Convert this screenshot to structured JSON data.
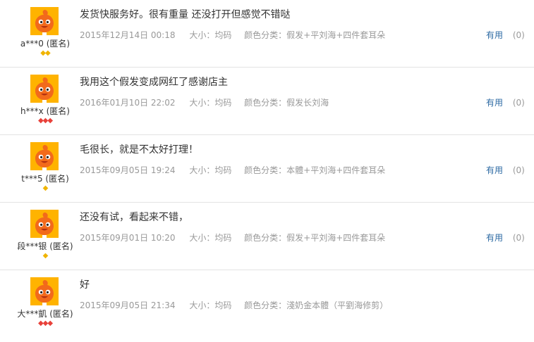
{
  "reviews": [
    {
      "user": "a***0 (匿名)",
      "badges": [
        {
          "color": "yellow"
        },
        {
          "color": "yellow"
        }
      ],
      "content": "发货快服务好。很有重量 还没打开但感觉不错哒",
      "date": "2015年12月14日 00:18",
      "size": "大小：均码",
      "color": "颜色分类：假发+平刘海+四件套耳朵",
      "useful_label": "有用",
      "useful_count": "(0)"
    },
    {
      "user": "h***x (匿名)",
      "badges": [
        {
          "color": "red"
        },
        {
          "color": "red"
        },
        {
          "color": "red"
        }
      ],
      "content": "我用这个假发变成网红了感谢店主",
      "date": "2016年01月10日 22:02",
      "size": "大小：均码",
      "color": "颜色分类：假发长刘海",
      "useful_label": "有用",
      "useful_count": "(0)"
    },
    {
      "user": "t***5 (匿名)",
      "badges": [
        {
          "color": "yellow"
        }
      ],
      "content": "毛很长，就是不太好打理！",
      "date": "2015年09月05日 19:24",
      "size": "大小：均码",
      "color": "颜色分类：本體+平刘海+四件套耳朵",
      "useful_label": "有用",
      "useful_count": "(0)"
    },
    {
      "user": "段***银 (匿名)",
      "badges": [
        {
          "color": "yellow"
        }
      ],
      "content": "还没有试，看起来不错，",
      "date": "2015年09月01日 10:20",
      "size": "大小：均码",
      "color": "颜色分类：假发+平刘海+四件套耳朵",
      "useful_label": "有用",
      "useful_count": "(0)"
    },
    {
      "user": "大***凱 (匿名)",
      "badges": [
        {
          "color": "red"
        },
        {
          "color": "red"
        },
        {
          "color": "red"
        }
      ],
      "content": "好",
      "date": "2015年09月05日 21:34",
      "size": "大小：均码",
      "color": "颜色分类：淺奶金本體（平劉海修剪）",
      "useful_label": "",
      "useful_count": ""
    }
  ]
}
